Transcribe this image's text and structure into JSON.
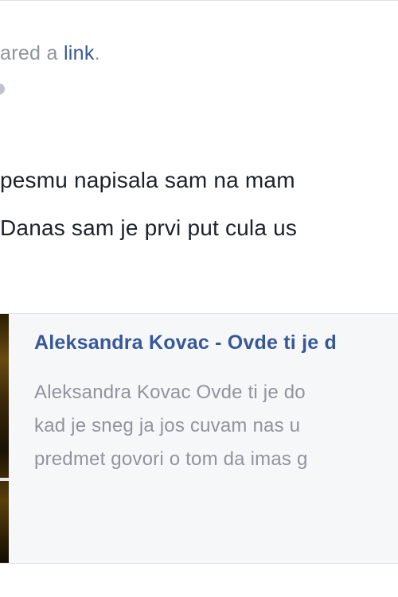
{
  "post": {
    "header_prefix": "ared a ",
    "header_link": "link",
    "header_suffix": ".",
    "text_lines": [
      "pesmu napisala sam na mam",
      "Danas sam je prvi put cula us"
    ]
  },
  "shared_link": {
    "title": "Aleksandra Kovac - Ovde ti je d",
    "description_lines": [
      "Aleksandra Kovac Ovde ti je do",
      "kad je sneg ja jos cuvam nas u",
      "predmet govori o tom da imas g"
    ]
  },
  "colors": {
    "link_blue": "#365899",
    "meta_gray": "#90949c",
    "text_dark": "#1d2129",
    "card_bg": "#f6f7f9"
  },
  "icons": {
    "privacy": "globe-icon"
  }
}
